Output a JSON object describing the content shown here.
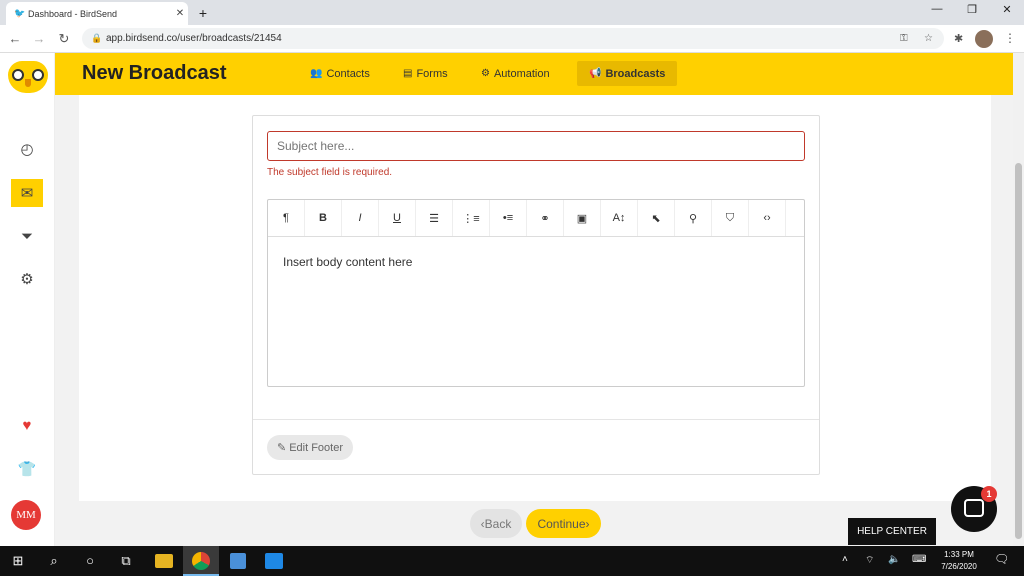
{
  "browser": {
    "tab_title": "Dashboard - BirdSend",
    "url": "app.birdsend.co/user/broadcasts/21454",
    "new_tab_label": "+",
    "close_label": "✕",
    "minimize_label": "—",
    "restore_label": "❐",
    "close_window_label": "✕"
  },
  "header": {
    "title": "New Broadcast",
    "tabs": [
      {
        "label": "Contacts",
        "icon": "contacts-icon"
      },
      {
        "label": "Forms",
        "icon": "forms-icon"
      },
      {
        "label": "Automation",
        "icon": "automation-icon"
      },
      {
        "label": "Broadcasts",
        "icon": "megaphone-icon",
        "active": true
      }
    ]
  },
  "sidebar": {
    "items": [
      "dashboard-icon",
      "mail-icon",
      "filter-icon",
      "gear-icon"
    ],
    "bottom": [
      "heart-icon",
      "shirt-icon"
    ],
    "avatar_initials": "MM"
  },
  "form": {
    "subject_placeholder": "Subject here...",
    "subject_error": "The subject field is required.",
    "body_placeholder": "Insert body content here",
    "edit_footer_label": "Edit Footer",
    "toolbar": [
      "¶",
      "B",
      "I",
      "U",
      "align-left",
      "ordered-list",
      "bullet-list",
      "link",
      "image",
      "font-size",
      "pointer",
      "person",
      "shield",
      "code"
    ]
  },
  "actions": {
    "back_label": "Back",
    "continue_label": "Continue"
  },
  "help": {
    "help_center_label": "HELP CENTER",
    "chat_badge": "1"
  },
  "taskbar": {
    "time": "1:33 PM",
    "date": "7/26/2020"
  },
  "colors": {
    "accent": "#ffd000",
    "error": "#c0392b",
    "avatar": "#e53935"
  }
}
